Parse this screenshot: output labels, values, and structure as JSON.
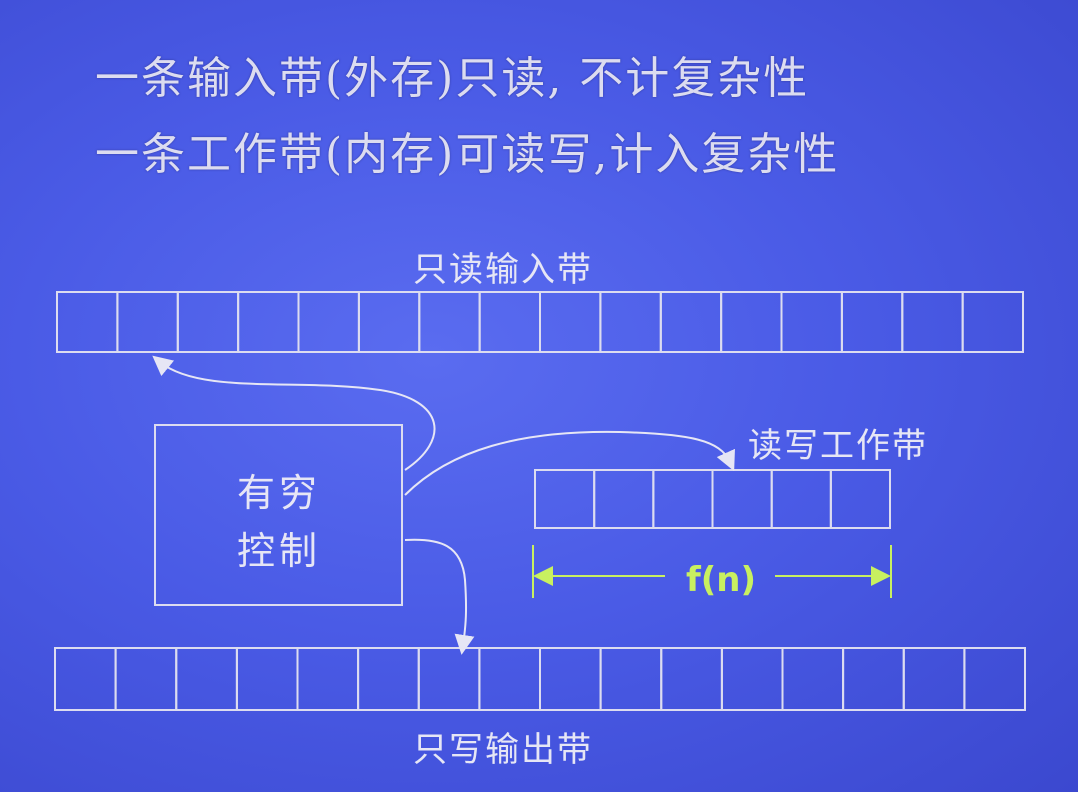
{
  "title": {
    "line1": "一条输入带(外存)只读, 不计复杂性",
    "line2": "一条工作带(内存)可读写,计入复杂性"
  },
  "input_tape": {
    "label": "只读输入带",
    "cells": 16
  },
  "work_tape": {
    "label": "读写工作带",
    "cells": 6
  },
  "output_tape": {
    "label": "只写输出带",
    "cells": 16
  },
  "control": {
    "line1": "有穷",
    "line2": "控制"
  },
  "work_size_label": "f(n)",
  "colors": {
    "background": "#4a5be6",
    "line": "#dcdcf0",
    "accent": "#c8f060"
  }
}
